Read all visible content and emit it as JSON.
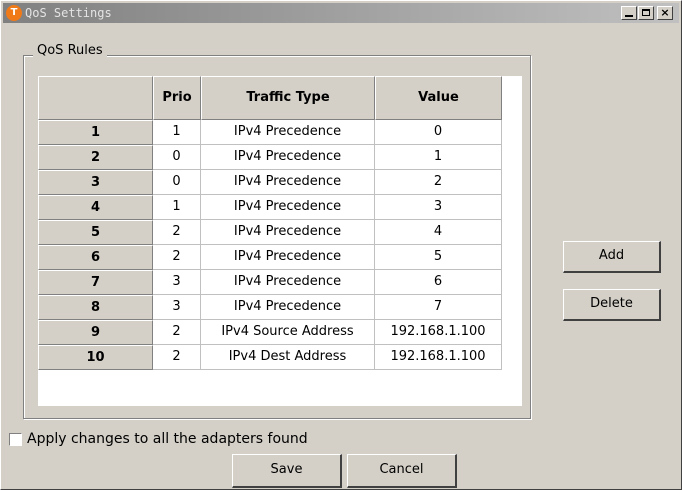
{
  "window": {
    "title": "QoS Settings",
    "icon": "app-logo-icon"
  },
  "group": {
    "label": "QoS Rules"
  },
  "table": {
    "columns": [
      "",
      "Prio",
      "Traffic Type",
      "Value"
    ],
    "rows": [
      {
        "num": "1",
        "prio": "1",
        "type": "IPv4 Precedence",
        "value": "0"
      },
      {
        "num": "2",
        "prio": "0",
        "type": "IPv4 Precedence",
        "value": "1"
      },
      {
        "num": "3",
        "prio": "0",
        "type": "IPv4 Precedence",
        "value": "2"
      },
      {
        "num": "4",
        "prio": "1",
        "type": "IPv4 Precedence",
        "value": "3"
      },
      {
        "num": "5",
        "prio": "2",
        "type": "IPv4 Precedence",
        "value": "4"
      },
      {
        "num": "6",
        "prio": "2",
        "type": "IPv4 Precedence",
        "value": "5"
      },
      {
        "num": "7",
        "prio": "3",
        "type": "IPv4 Precedence",
        "value": "6"
      },
      {
        "num": "8",
        "prio": "3",
        "type": "IPv4 Precedence",
        "value": "7"
      },
      {
        "num": "9",
        "prio": "2",
        "type": "IPv4 Source Address",
        "value": "192.168.1.100"
      },
      {
        "num": "10",
        "prio": "2",
        "type": "IPv4 Dest Address",
        "value": "192.168.1.100"
      }
    ]
  },
  "buttons": {
    "add": "Add",
    "delete": "Delete",
    "save": "Save",
    "cancel": "Cancel"
  },
  "options": {
    "apply_all_label": "Apply changes to all the adapters found",
    "apply_all_checked": false
  }
}
